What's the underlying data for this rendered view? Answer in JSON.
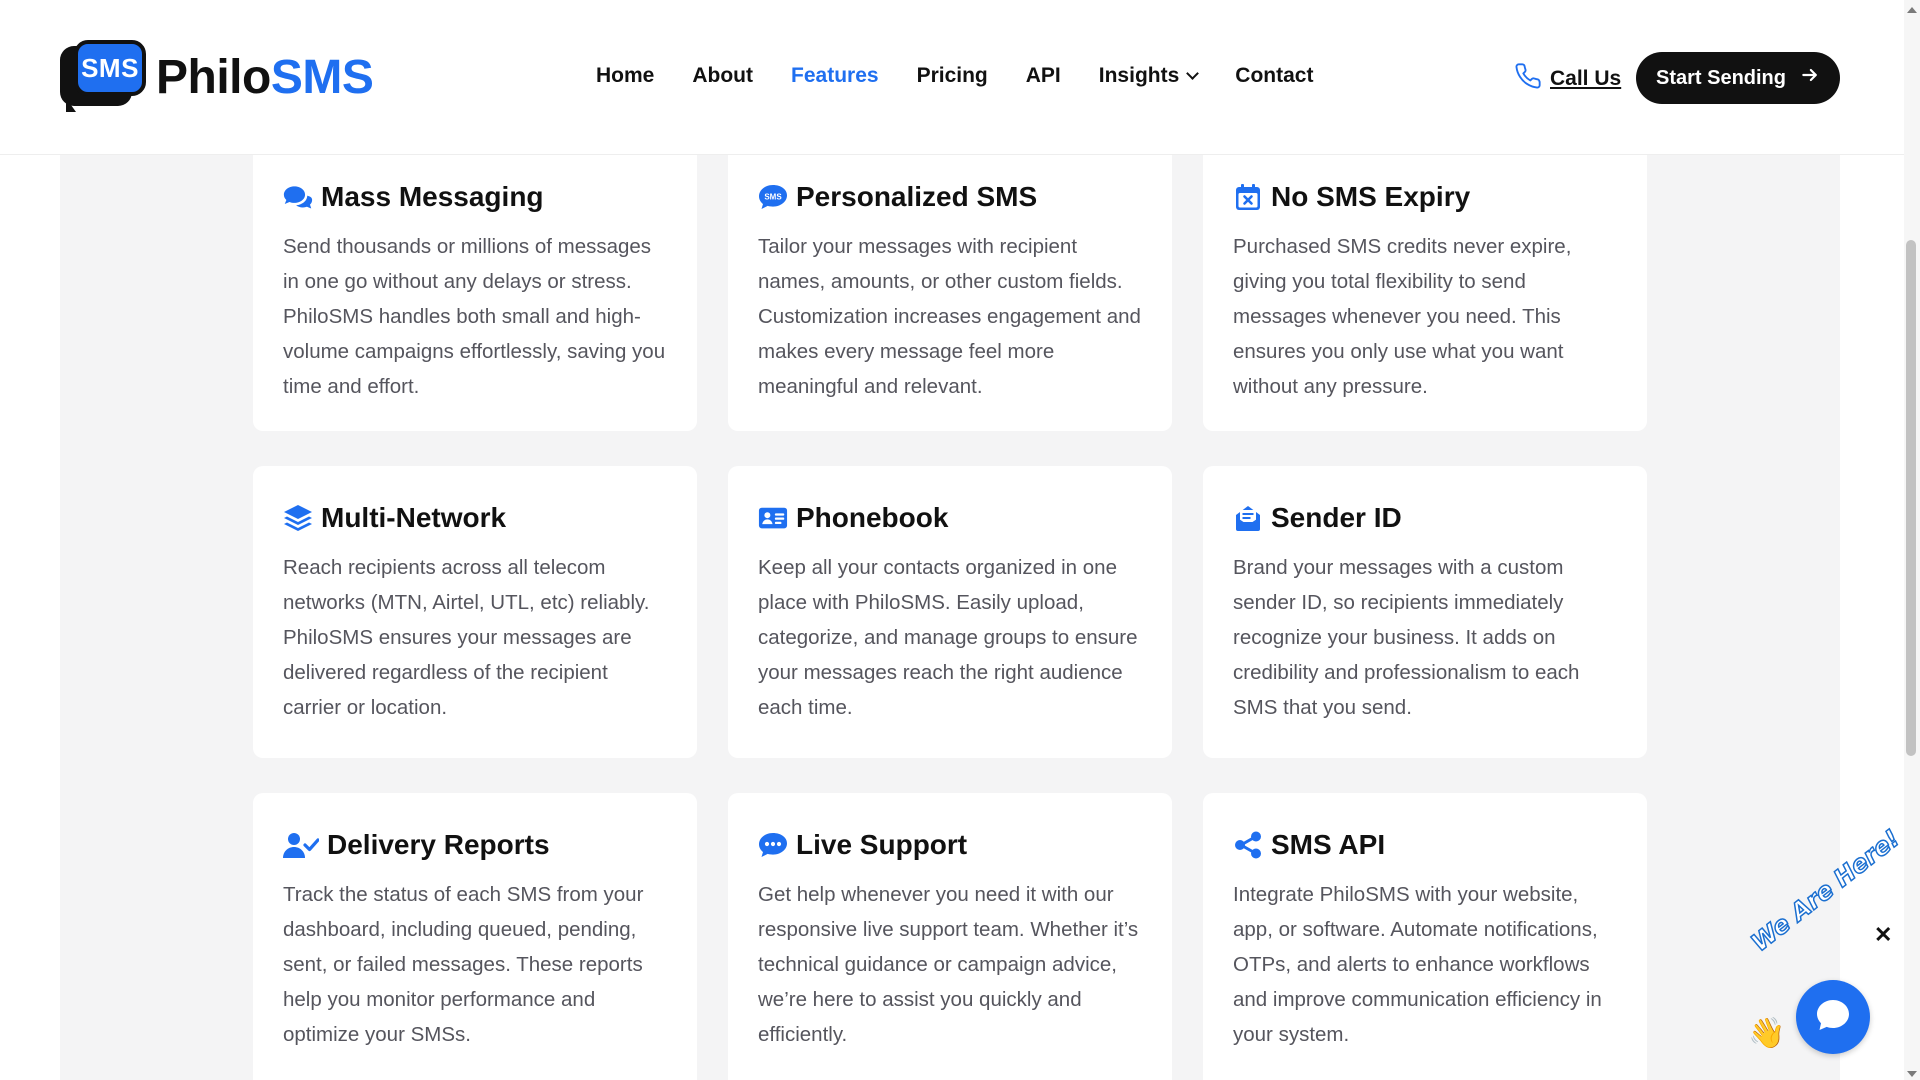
{
  "header": {
    "logo": {
      "badge": "SMS",
      "brand_part1": "Philo",
      "brand_part2": "SMS"
    },
    "nav": [
      {
        "label": "Home",
        "active": false
      },
      {
        "label": "About",
        "active": false
      },
      {
        "label": "Features",
        "active": true
      },
      {
        "label": "Pricing",
        "active": false
      },
      {
        "label": "API",
        "active": false
      },
      {
        "label": "Insights",
        "active": false,
        "has_dropdown": true
      },
      {
        "label": "Contact",
        "active": false
      }
    ],
    "call_label": "Call Us",
    "start_label": "Start Sending"
  },
  "features": [
    {
      "icon": "comments-icon",
      "title": "Mass Messaging",
      "desc": "Send thousands or millions of messages in one go without any delays or stress. PhiloSMS handles both small and high-volume campaigns effortlessly, saving you time and effort."
    },
    {
      "icon": "sms-bubble-icon",
      "title": "Personalized SMS",
      "desc": "Tailor your messages with recipient names, amounts, or other custom fields. Customization increases engagement and makes every message feel more meaningful and relevant."
    },
    {
      "icon": "calendar-x-icon",
      "title": "No SMS Expiry",
      "desc": "Purchased SMS credits never expire, giving you total flexibility to send messages whenever you need. This ensures you only use what you want without any pressure."
    },
    {
      "icon": "layers-icon",
      "title": "Multi-Network",
      "desc": "Reach recipients across all telecom networks (MTN, Airtel, UTL, etc) reliably. PhiloSMS ensures your messages are delivered regardless of the recipient carrier or location."
    },
    {
      "icon": "contact-card-icon",
      "title": "Phonebook",
      "desc": "Keep all your contacts organized in one place with PhiloSMS. Easily upload, categorize, and manage groups to ensure your messages reach the right audience each time."
    },
    {
      "icon": "envelope-open-icon",
      "title": "Sender ID",
      "desc": "Brand your messages with a custom sender ID, so recipients immediately recognize your business. It adds on credibility and professionalism to each SMS that you send."
    },
    {
      "icon": "user-check-icon",
      "title": "Delivery Reports",
      "desc": "Track the status of each SMS from your dashboard, including queued, pending, sent, or failed messages. These reports help you monitor performance and optimize your SMSs."
    },
    {
      "icon": "chat-dots-icon",
      "title": "Live Support",
      "desc": "Get help whenever you need it with our responsive live support team. Whether it’s technical guidance or campaign advice, we’re here to assist you quickly and efficiently."
    },
    {
      "icon": "share-nodes-icon",
      "title": "SMS API",
      "desc": "Integrate PhiloSMS with your website, app, or software. Automate notifications, OTPs, and alerts to enhance workflows and improve communication efficiency in your system."
    }
  ],
  "chat": {
    "label": "We Are Here!",
    "hand": "👋",
    "close": "✕"
  },
  "colors": {
    "accent": "#1f6ff0",
    "dark": "#111111",
    "muted_text": "#55555d",
    "backdrop": "#f4f4f5"
  }
}
